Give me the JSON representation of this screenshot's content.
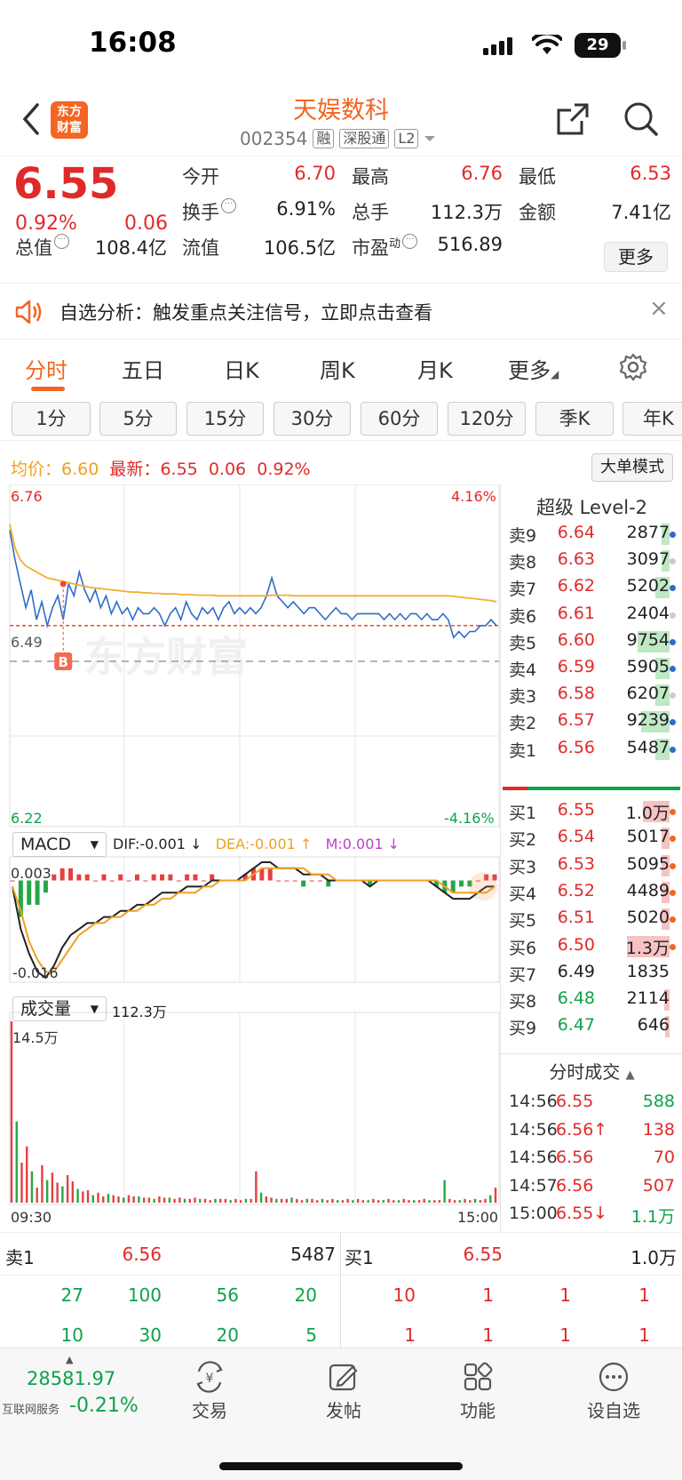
{
  "status": {
    "time": "16:08",
    "battery": "29"
  },
  "header": {
    "title": "天娱数科",
    "code": "002354",
    "tags": [
      "融",
      "深股通",
      "L2"
    ],
    "logo_text": [
      "东方",
      "财富"
    ]
  },
  "quote": {
    "price": "6.55",
    "change_pct": "0.92%",
    "change": "0.06",
    "fields": [
      {
        "label": "今开",
        "value": "6.70",
        "color": "red"
      },
      {
        "label": "最高",
        "value": "6.76",
        "color": "red"
      },
      {
        "label": "最低",
        "value": "6.53",
        "color": "red"
      },
      {
        "label": "换手",
        "value": "6.91%",
        "color": "dark"
      },
      {
        "label": "总手",
        "value": "112.3万",
        "color": "dark"
      },
      {
        "label": "金额",
        "value": "7.41亿",
        "color": "dark"
      },
      {
        "label": "总值",
        "value": "108.4亿",
        "color": "dark"
      },
      {
        "label": "流值",
        "value": "106.5亿",
        "color": "dark"
      },
      {
        "label": "市盈",
        "label_sup": "动",
        "value": "516.89",
        "color": "dark"
      }
    ],
    "more_label": "更多"
  },
  "banner": {
    "text": "自选分析：触发重点关注信号，立即点击查看",
    "close": "×"
  },
  "tabs": [
    "分时",
    "五日",
    "日K",
    "周K",
    "月K",
    "更多"
  ],
  "intervals": [
    "1分",
    "5分",
    "15分",
    "30分",
    "60分",
    "120分",
    "季K",
    "年K"
  ],
  "avg_row": {
    "avg_label": "均价：",
    "avg": "6.60",
    "last_label": "最新：",
    "last": "6.55",
    "chg": "0.06",
    "pct": "0.92%",
    "big_order_label": "大单模式"
  },
  "chart_data": [
    {
      "type": "line",
      "title": "分时",
      "y_max_label": "6.76",
      "y_min_label": "6.22",
      "pct_max_label": "4.16%",
      "pct_min_label": "-4.16%",
      "prev_close_label": "6.49",
      "ylim": [
        6.22,
        6.76
      ],
      "buy_marker": "B",
      "series": [
        {
          "name": "最新",
          "color": "#2f6cc8",
          "values": [
            6.71,
            6.66,
            6.62,
            6.58,
            6.61,
            6.56,
            6.59,
            6.55,
            6.58,
            6.6,
            6.56,
            6.62,
            6.6,
            6.64,
            6.61,
            6.59,
            6.61,
            6.58,
            6.6,
            6.57,
            6.59,
            6.57,
            6.58,
            6.56,
            6.58,
            6.57,
            6.57,
            6.58,
            6.57,
            6.55,
            6.57,
            6.58,
            6.56,
            6.59,
            6.57,
            6.56,
            6.58,
            6.57,
            6.58,
            6.56,
            6.58,
            6.59,
            6.57,
            6.58,
            6.57,
            6.58,
            6.57,
            6.58,
            6.6,
            6.63,
            6.6,
            6.59,
            6.58,
            6.59,
            6.58,
            6.57,
            6.58,
            6.58,
            6.57,
            6.56,
            6.57,
            6.58,
            6.57,
            6.57,
            6.56,
            6.57,
            6.57,
            6.57,
            6.57,
            6.57,
            6.56,
            6.57,
            6.56,
            6.57,
            6.56,
            6.57,
            6.57,
            6.56,
            6.57,
            6.56,
            6.56,
            6.57,
            6.56,
            6.53,
            6.54,
            6.53,
            6.54,
            6.54,
            6.55,
            6.55,
            6.56,
            6.55
          ]
        },
        {
          "name": "均价",
          "color": "#f0b030",
          "values": [
            6.72,
            6.68,
            6.66,
            6.65,
            6.645,
            6.64,
            6.635,
            6.63,
            6.628,
            6.626,
            6.624,
            6.622,
            6.62,
            6.618,
            6.616,
            6.614,
            6.613,
            6.612,
            6.611,
            6.61,
            6.609,
            6.608,
            6.607,
            6.606,
            6.606,
            6.605,
            6.605,
            6.604,
            6.604,
            6.603,
            6.603,
            6.603,
            6.602,
            6.602,
            6.602,
            6.601,
            6.601,
            6.601,
            6.601,
            6.6,
            6.6,
            6.6,
            6.6,
            6.6,
            6.6,
            6.6,
            6.6,
            6.6,
            6.6,
            6.601,
            6.601,
            6.601,
            6.601,
            6.6,
            6.6,
            6.6,
            6.6,
            6.6,
            6.6,
            6.6,
            6.6,
            6.6,
            6.6,
            6.6,
            6.6,
            6.6,
            6.6,
            6.6,
            6.6,
            6.6,
            6.6,
            6.6,
            6.6,
            6.6,
            6.6,
            6.6,
            6.6,
            6.6,
            6.6,
            6.6,
            6.6,
            6.6,
            6.6,
            6.599,
            6.598,
            6.597,
            6.596,
            6.595,
            6.594,
            6.593,
            6.592,
            6.59
          ]
        }
      ]
    },
    {
      "type": "bar",
      "title": "MACD",
      "dif_label": "DIF:-0.001 ↓",
      "dea_label": "DEA:-0.001 ↑",
      "m_label": "M:0.001 ↓",
      "y_max_label": "0.003",
      "y_min_label": "-0.016",
      "ylim": [
        -0.016,
        0.003
      ],
      "series": [
        {
          "name": "DIF",
          "color": "#222222",
          "values": [
            -0.001,
            -0.008,
            -0.012,
            -0.015,
            -0.016,
            -0.014,
            -0.011,
            -0.009,
            -0.008,
            -0.007,
            -0.007,
            -0.006,
            -0.006,
            -0.005,
            -0.005,
            -0.004,
            -0.004,
            -0.003,
            -0.002,
            -0.002,
            -0.002,
            -0.001,
            -0.001,
            -0.001,
            0.0,
            0.0,
            0.0,
            0.0,
            0.001,
            0.002,
            0.003,
            0.003,
            0.002,
            0.002,
            0.002,
            0.001,
            0.001,
            0.001,
            0.0,
            0.0,
            0.0,
            0.0,
            0.0,
            -0.001,
            0.0,
            0.0,
            0.0,
            0.0,
            0.0,
            0.0,
            0.0,
            -0.001,
            -0.002,
            -0.003,
            -0.003,
            -0.003,
            -0.002,
            -0.001,
            -0.001
          ]
        },
        {
          "name": "DEA",
          "color": "#f0a020",
          "values": [
            -0.001,
            -0.005,
            -0.01,
            -0.013,
            -0.015,
            -0.015,
            -0.013,
            -0.011,
            -0.009,
            -0.008,
            -0.007,
            -0.007,
            -0.006,
            -0.006,
            -0.005,
            -0.005,
            -0.004,
            -0.004,
            -0.003,
            -0.003,
            -0.002,
            -0.002,
            -0.002,
            -0.001,
            -0.001,
            0.0,
            0.0,
            0.0,
            0.0,
            0.001,
            0.002,
            0.002,
            0.002,
            0.002,
            0.002,
            0.002,
            0.001,
            0.001,
            0.001,
            0.0,
            0.0,
            0.0,
            0.0,
            0.0,
            0.0,
            0.0,
            0.0,
            0.0,
            0.0,
            0.0,
            0.0,
            0.0,
            -0.001,
            -0.002,
            -0.002,
            -0.002,
            -0.002,
            -0.002,
            -0.001
          ]
        }
      ],
      "histogram": [
        0.0,
        -0.006,
        -0.004,
        -0.004,
        -0.002,
        0.001,
        0.002,
        0.002,
        0.001,
        0.001,
        0.0,
        0.001,
        0.0,
        0.001,
        0.0,
        0.001,
        0.0,
        0.001,
        0.001,
        0.001,
        0.0,
        0.001,
        0.001,
        0.0,
        0.001,
        0.0,
        0.0,
        0.0,
        0.001,
        0.002,
        0.002,
        0.002,
        0.0,
        0.0,
        0.0,
        -0.001,
        0.0,
        0.0,
        -0.001,
        0.0,
        0.0,
        0.0,
        0.0,
        -0.001,
        0.0,
        0.0,
        0.0,
        0.0,
        0.0,
        0.0,
        0.0,
        -0.001,
        -0.002,
        -0.002,
        -0.001,
        -0.001,
        0.0,
        0.001,
        0.001
      ]
    },
    {
      "type": "bar",
      "title": "成交量",
      "total_label": "112.3万",
      "y_max_label": "14.5万",
      "x_start": "09:30",
      "x_end": "15:00",
      "values": [
        14.5,
        6.5,
        3.2,
        4.5,
        2.5,
        1.2,
        3.0,
        1.8,
        2.4,
        1.6,
        1.3,
        2.2,
        1.7,
        1.1,
        0.9,
        1.0,
        0.6,
        0.8,
        0.5,
        0.7,
        0.6,
        0.5,
        0.4,
        0.6,
        0.5,
        0.5,
        0.4,
        0.4,
        0.3,
        0.5,
        0.4,
        0.4,
        0.3,
        0.4,
        0.3,
        0.3,
        0.4,
        0.3,
        0.3,
        0.2,
        0.3,
        0.3,
        0.3,
        0.2,
        0.3,
        0.2,
        0.3,
        0.3,
        2.5,
        0.8,
        0.5,
        0.4,
        0.3,
        0.3,
        0.3,
        0.4,
        0.3,
        0.2,
        0.3,
        0.3,
        0.2,
        0.3,
        0.2,
        0.3,
        0.2,
        0.2,
        0.3,
        0.2,
        0.3,
        0.2,
        0.2,
        0.3,
        0.2,
        0.2,
        0.3,
        0.2,
        0.2,
        0.3,
        0.2,
        0.2,
        0.2,
        0.3,
        0.2,
        0.2,
        0.2,
        1.8,
        0.3,
        0.2,
        0.2,
        0.3,
        0.2,
        0.3,
        0.2,
        0.3,
        0.6,
        1.2
      ]
    }
  ],
  "order_book": {
    "title": "超级 Level-2",
    "asks": [
      {
        "label": "卖9",
        "price": "6.64",
        "vol": "2877",
        "vbar": 0.11,
        "dot": "#2f6cc8"
      },
      {
        "label": "卖8",
        "price": "6.63",
        "vol": "3097",
        "vbar": 0.11,
        "dot": "#cccccc"
      },
      {
        "label": "卖7",
        "price": "6.62",
        "vol": "5202",
        "vbar": 0.2,
        "dot": "#2f6cc8"
      },
      {
        "label": "卖6",
        "price": "6.61",
        "vol": "2404",
        "vbar": 0.0,
        "dot": "#cccccc"
      },
      {
        "label": "卖5",
        "price": "6.60",
        "vol": "9754",
        "vbar": 0.45,
        "dot": "#2f6cc8"
      },
      {
        "label": "卖4",
        "price": "6.59",
        "vol": "5905",
        "vbar": 0.2,
        "dot": "#2f6cc8"
      },
      {
        "label": "卖3",
        "price": "6.58",
        "vol": "6207",
        "vbar": 0.2,
        "dot": "#cccccc"
      },
      {
        "label": "卖2",
        "price": "6.57",
        "vol": "9239",
        "vbar": 0.4,
        "dot": "#2f6cc8"
      },
      {
        "label": "卖1",
        "price": "6.56",
        "vol": "5487",
        "vbar": 0.2,
        "dot": "#2f6cc8"
      }
    ],
    "bids": [
      {
        "label": "买1",
        "price": "6.55",
        "vol": "1.0万",
        "vbar": 0.38,
        "dot": "#f26522",
        "pcolor": "red"
      },
      {
        "label": "买2",
        "price": "6.54",
        "vol": "5017",
        "vbar": 0.11,
        "dot": "#f26522",
        "pcolor": "red"
      },
      {
        "label": "买3",
        "price": "6.53",
        "vol": "5095",
        "vbar": 0.11,
        "dot": "#f26522",
        "pcolor": "red"
      },
      {
        "label": "买4",
        "price": "6.52",
        "vol": "4489",
        "vbar": 0.11,
        "dot": "#f26522",
        "pcolor": "red"
      },
      {
        "label": "买5",
        "price": "6.51",
        "vol": "5020",
        "vbar": 0.11,
        "dot": "#f26522",
        "pcolor": "red"
      },
      {
        "label": "买6",
        "price": "6.50",
        "vol": "1.3万",
        "vbar": 0.6,
        "dot": "#f26522",
        "pcolor": "red"
      },
      {
        "label": "买7",
        "price": "6.49",
        "vol": "1835",
        "vbar": 0.0,
        "dot": "",
        "pcolor": "dark"
      },
      {
        "label": "买8",
        "price": "6.48",
        "vol": "2114",
        "vbar": 0.08,
        "dot": "",
        "pcolor": "green"
      },
      {
        "label": "买9",
        "price": "6.47",
        "vol": "646",
        "vbar": 0.06,
        "dot": "",
        "pcolor": "green"
      }
    ],
    "trades_title": "分时成交",
    "trades": [
      {
        "time": "14:56",
        "price": "6.55",
        "vol": "588",
        "vcolor": "green"
      },
      {
        "time": "14:56",
        "price": "6.56↑",
        "vol": "138",
        "vcolor": "red"
      },
      {
        "time": "14:56",
        "price": "6.56",
        "vol": "70",
        "vcolor": "red"
      },
      {
        "time": "14:57",
        "price": "6.56",
        "vol": "507",
        "vcolor": "red"
      },
      {
        "time": "15:00",
        "price": "6.55↓",
        "vol": "1.1万",
        "vcolor": "green"
      }
    ]
  },
  "summary": {
    "ask1_label": "卖1",
    "ask1_price": "6.56",
    "ask1_vol": "5487",
    "bid1_label": "买1",
    "bid1_price": "6.55",
    "bid1_vol": "1.0万",
    "ask_rows": [
      [
        "27",
        "100",
        "56",
        "20"
      ],
      [
        "10",
        "30",
        "20",
        "5"
      ]
    ],
    "bid_rows": [
      [
        "10",
        "1",
        "1",
        "1"
      ],
      [
        "1",
        "1",
        "1",
        "1"
      ]
    ]
  },
  "bottom": {
    "index_value": "28581.97",
    "index_name": "互联网服务",
    "index_pct": "-0.21%",
    "nav": [
      "交易",
      "发帖",
      "功能",
      "设自选"
    ]
  }
}
